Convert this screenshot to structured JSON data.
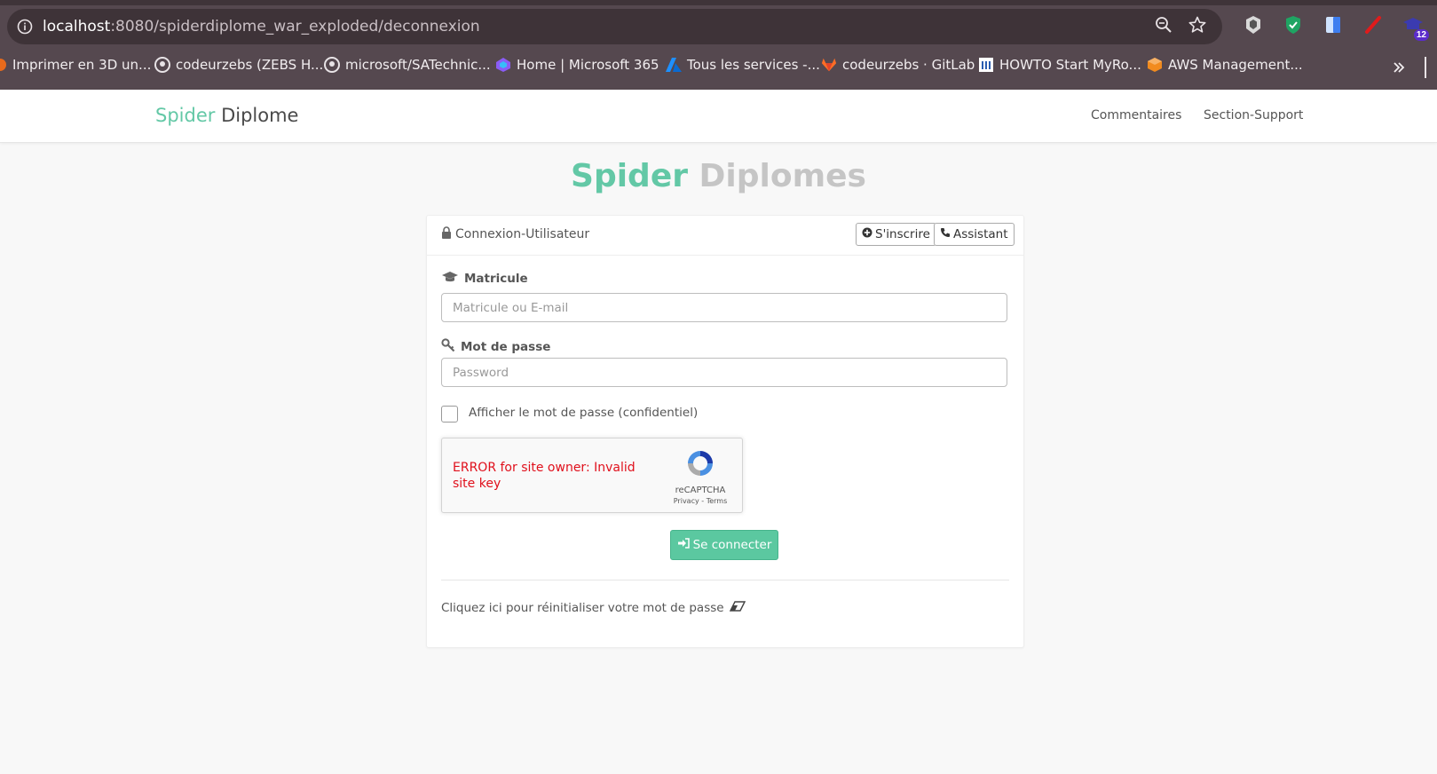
{
  "browser": {
    "url_host": "localhost",
    "url_path": ":8080/spiderdiplome_war_exploded/deconnexion",
    "bookmarks": [
      {
        "label": "Imprimer en 3D un...",
        "icon": "printer-3d-icon"
      },
      {
        "label": "codeurzebs (ZEBS H...",
        "icon": "github-icon"
      },
      {
        "label": "microsoft/SATechnic...",
        "icon": "github-icon"
      },
      {
        "label": "Home | Microsoft 365",
        "icon": "microsoft-365-icon"
      },
      {
        "label": "Tous les services -...",
        "icon": "azure-icon"
      },
      {
        "label": "codeurzebs · GitLab",
        "icon": "gitlab-icon"
      },
      {
        "label": "HOWTO Start MyRo...",
        "icon": "bookmark-icon"
      },
      {
        "label": "AWS Management...",
        "icon": "aws-icon"
      }
    ],
    "extension_badge": "12"
  },
  "navbar": {
    "brand_part1": "Spider",
    "brand_part2": "Diplome",
    "links": [
      "Commentaires",
      "Section-Support"
    ]
  },
  "page": {
    "title_part1": "Spider",
    "title_part2": "Diplomes"
  },
  "login": {
    "panel_title": "Connexion-Utilisateur",
    "register_label": "S'inscrire",
    "assistant_label": "Assistant",
    "matricule_label": "Matricule",
    "matricule_placeholder": "Matricule ou E-mail",
    "password_label": "Mot de passe",
    "password_placeholder": "Password",
    "show_password_label": "Afficher le mot de passe (confidentiel)",
    "recaptcha_error": "ERROR for site owner: Invalid site key",
    "recaptcha_name": "reCAPTCHA",
    "recaptcha_terms": "Privacy - Terms",
    "submit_label": "Se connecter",
    "reset_text": "Cliquez ici pour réinitialiser votre mot de passe"
  },
  "colors": {
    "accent": "#63c8a6",
    "button": "#5bc8a0",
    "browser_frame": "#55484f"
  }
}
